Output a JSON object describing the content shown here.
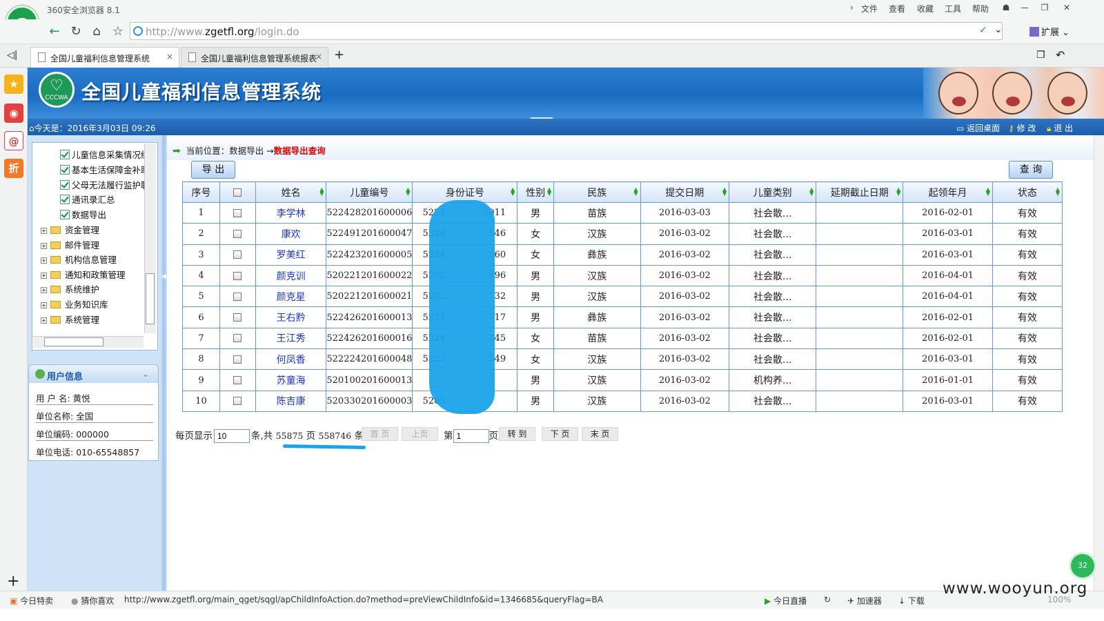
{
  "browser": {
    "title": "360安全浏览器 8.1",
    "menus": [
      "文件",
      "查看",
      "收藏",
      "工具",
      "帮助"
    ],
    "url_prefix": "http://www.",
    "url_domain": "zgetfl.org",
    "url_path": "/login.do",
    "extension_label": "扩展",
    "tabs": [
      {
        "label": "全国儿童福利信息管理系统"
      },
      {
        "label": "全国儿童福利信息管理系统报表"
      }
    ]
  },
  "app": {
    "logo_text": "CCCWA",
    "title": "全国儿童福利信息管理系统",
    "date_label": "今天是：2016年3月03日 09:26",
    "top_links": [
      "返回桌面",
      "修 改",
      "退 出"
    ]
  },
  "tree": {
    "leaf_items": [
      "儿童信息采集情况统",
      "基本生活保障金补助",
      "父母无法履行监护职",
      "通讯录汇总",
      "数据导出"
    ],
    "folders": [
      "资金管理",
      "邮件管理",
      "机构信息管理",
      "通知和政策管理",
      "系统维护",
      "业务知识库",
      "系统管理"
    ]
  },
  "user": {
    "title": "用户信息",
    "rows": [
      {
        "label": "用 户 名:",
        "value": "黄悦"
      },
      {
        "label": "单位名称:",
        "value": "全国"
      },
      {
        "label": "单位编码:",
        "value": "000000"
      },
      {
        "label": "单位电话:",
        "value": "010-65548857"
      }
    ]
  },
  "main": {
    "breadcrumb_prefix": "当前位置：数据导出 →",
    "breadcrumb_current": "数据导出查询",
    "export_button": "导 出",
    "query_button": "查 询"
  },
  "grid": {
    "headers": [
      "序号",
      "",
      "姓名",
      "儿童编号",
      "身份证号",
      "性别",
      "民族",
      "提交日期",
      "儿童类别",
      "延期截止日期",
      "起领年月",
      "状态"
    ],
    "rows": [
      {
        "no": "1",
        "name": "李学林",
        "code": "522428201600006",
        "id": "5224",
        "id_tail": "5011",
        "sex": "男",
        "ethnic": "苗族",
        "submit": "2016-03-03",
        "category": "社会散...",
        "extend": "",
        "start": "2016-02-01",
        "status": "有效"
      },
      {
        "no": "2",
        "name": "康欢",
        "code": "522491201600047",
        "id": "5224",
        "id_tail": "546",
        "sex": "女",
        "ethnic": "汉族",
        "submit": "2016-03-02",
        "category": "社会散...",
        "extend": "",
        "start": "2016-03-01",
        "status": "有效"
      },
      {
        "no": "3",
        "name": "罗美红",
        "code": "522423201600005",
        "id": "5224",
        "id_tail": "560",
        "sex": "女",
        "ethnic": "彝族",
        "submit": "2016-03-02",
        "category": "社会散...",
        "extend": "",
        "start": "2016-03-01",
        "status": "有效"
      },
      {
        "no": "4",
        "name": "颜克训",
        "code": "520221201600022",
        "id": "5202",
        "id_tail": "896",
        "sex": "男",
        "ethnic": "汉族",
        "submit": "2016-03-02",
        "category": "社会散...",
        "extend": "",
        "start": "2016-04-01",
        "status": "有效"
      },
      {
        "no": "5",
        "name": "颜克星",
        "code": "520221201600021",
        "id": "5202",
        "id_tail": "732",
        "sex": "男",
        "ethnic": "汉族",
        "submit": "2016-03-02",
        "category": "社会散...",
        "extend": "",
        "start": "2016-04-01",
        "status": "有效"
      },
      {
        "no": "6",
        "name": "王右黔",
        "code": "522426201600013",
        "id": "5224",
        "id_tail": "717",
        "sex": "男",
        "ethnic": "彝族",
        "submit": "2016-03-02",
        "category": "社会散...",
        "extend": "",
        "start": "2016-02-01",
        "status": "有效"
      },
      {
        "no": "7",
        "name": "王江秀",
        "code": "522426201600016",
        "id": "5224",
        "id_tail": "345",
        "sex": "女",
        "ethnic": "苗族",
        "submit": "2016-03-02",
        "category": "社会散...",
        "extend": "",
        "start": "2016-02-01",
        "status": "有效"
      },
      {
        "no": "8",
        "name": "何凤香",
        "code": "522224201600048",
        "id": "5222",
        "id_tail": "549",
        "sex": "女",
        "ethnic": "汉族",
        "submit": "2016-03-02",
        "category": "社会散...",
        "extend": "",
        "start": "2016-03-01",
        "status": "有效"
      },
      {
        "no": "9",
        "name": "苏童海",
        "code": "520100201600013",
        "id": "",
        "id_tail": "",
        "sex": "男",
        "ethnic": "汉族",
        "submit": "2016-03-02",
        "category": "机构养...",
        "extend": "",
        "start": "2016-01-01",
        "status": "有效"
      },
      {
        "no": "10",
        "name": "陈吉康",
        "code": "520330201600003",
        "id": "5203",
        "id_tail": "",
        "sex": "男",
        "ethnic": "汉族",
        "submit": "2016-03-02",
        "category": "社会散...",
        "extend": "",
        "start": "2016-03-01",
        "status": "有效"
      }
    ]
  },
  "pager": {
    "per_page_label": "每页显示",
    "per_page_value": "10",
    "total_prefix": "条,共",
    "total_pages": "55875",
    "page_unit": "页",
    "total_records": "558746",
    "record_unit": "条",
    "first": "首 页",
    "prev": "上页",
    "page_prefix": "第",
    "page_value": "1",
    "page_suffix": "页",
    "goto": "转 到",
    "next": "下 页",
    "last": "末 页"
  },
  "status": {
    "left1": "今日特卖",
    "left2": "猜你喜欢",
    "url": "http://www.zgetfl.org/main_qget/sqgl/apChildInfoAction.do?method=preViewChildInfo&id=1346685&queryFlag=BA",
    "live": "今日直播",
    "accel": "加速器",
    "download": "下载",
    "zoom": "100%",
    "badge": "32"
  },
  "watermark": "www.wooyun.org"
}
